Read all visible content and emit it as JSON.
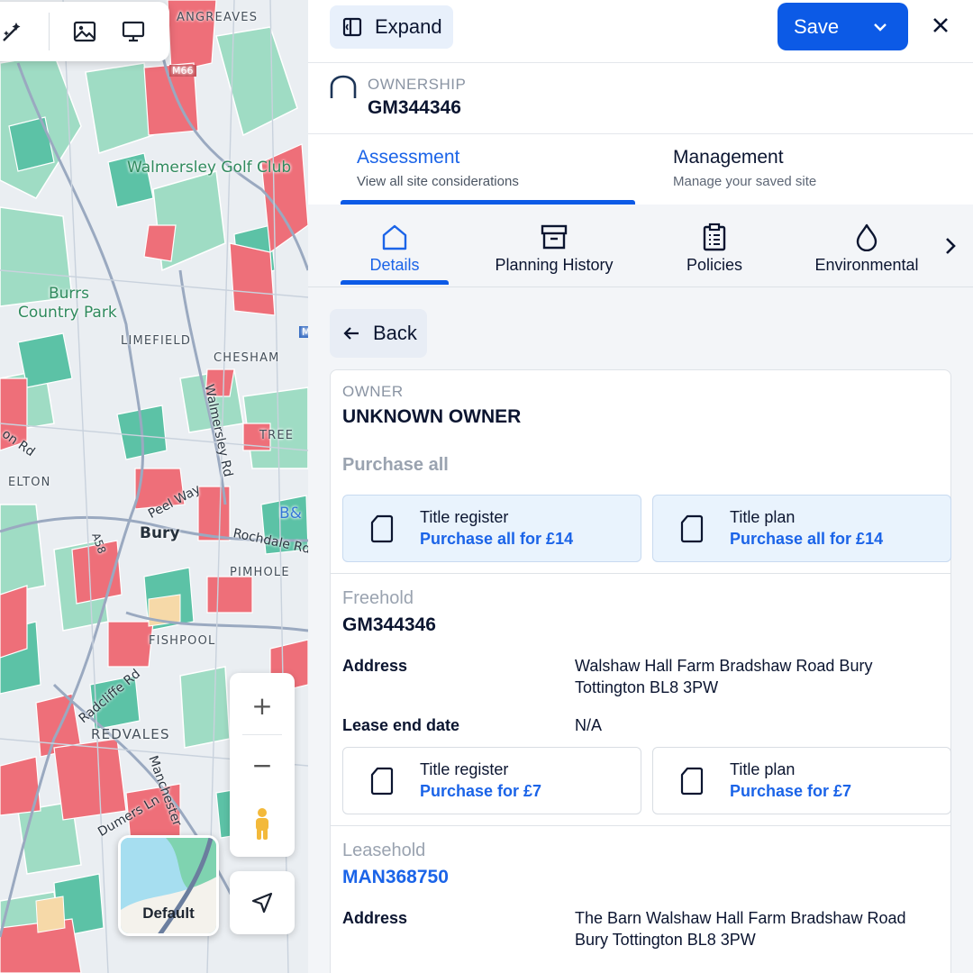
{
  "map": {
    "labels": {
      "angreaves": "ANGREAVES",
      "golf": "Walmersley Golf Club",
      "burrs": "Burrs",
      "country_park": "Country Park",
      "limefield": "LIMEFIELD",
      "chesham": "CHESHAM",
      "walmersley_rd": "Walmersley Rd",
      "on_rd": "on Rd",
      "elton": "ELTON",
      "peel_way": "Peel Way",
      "bury": "Bury",
      "a58": "A58",
      "rochdale_rd": "Rochdale Rd",
      "pimhole": "PIMHOLE",
      "fishpool": "FISHPOOL",
      "radcliffe_rd": "Radcliffe Rd",
      "redvales": "REDVALES",
      "manchester": "Manchester",
      "dumers_ln": "Dumers Ln",
      "m66": "M66",
      "m_sign": "M",
      "b_and": "B&",
      "tree": "TREE"
    },
    "toolbar_icons": [
      "magic-wand-icon",
      "image-icon",
      "monitor-icon"
    ],
    "zoom_in": "+",
    "zoom_out": "−",
    "layer_label": "Default"
  },
  "panel": {
    "expand_label": "Expand",
    "save_label": "Save",
    "ownership_kicker": "OWNERSHIP",
    "ownership_code": "GM344346",
    "main_tabs": [
      {
        "title": "Assessment",
        "subtitle": "View all site considerations"
      },
      {
        "title": "Management",
        "subtitle": "Manage your saved site"
      }
    ],
    "sub_tabs": [
      {
        "label": "Details",
        "icon": "home-icon"
      },
      {
        "label": "Planning History",
        "icon": "archive-icon"
      },
      {
        "label": "Policies",
        "icon": "clipboard-icon"
      },
      {
        "label": "Environmental",
        "icon": "droplet-icon"
      }
    ],
    "back_label": "Back",
    "owner": {
      "kicker": "OWNER",
      "name": "UNKNOWN OWNER",
      "purchase_all": "Purchase all",
      "docs": [
        {
          "title": "Title register",
          "link": "Purchase all for £14"
        },
        {
          "title": "Title plan",
          "link": "Purchase all for £14"
        }
      ]
    },
    "freehold": {
      "kicker": "Freehold",
      "code": "GM344346",
      "address_label": "Address",
      "address_line1": "Walshaw Hall Farm Bradshaw Road Bury",
      "address_line2": "Tottington BL8 3PW",
      "lease_label": "Lease end date",
      "lease_value": "N/A",
      "docs": [
        {
          "title": "Title register",
          "link": "Purchase for £7"
        },
        {
          "title": "Title plan",
          "link": "Purchase for £7"
        }
      ]
    },
    "leasehold": {
      "kicker": "Leasehold",
      "code": "MAN368750",
      "address_label": "Address",
      "address_line1": "The Barn Walshaw Hall Farm Bradshaw Road",
      "address_line2": "Bury Tottington BL8 3PW"
    }
  },
  "colors": {
    "primary": "#0c5ae6",
    "link": "#1b64e8",
    "map_red": "#ef6f7a",
    "map_teal": "#5fc4a8",
    "map_green": "#bfe7cf"
  }
}
